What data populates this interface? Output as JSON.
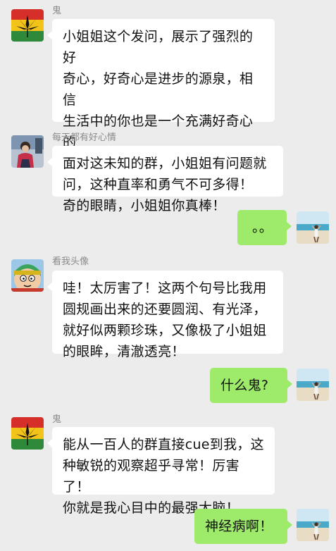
{
  "chat": {
    "messages": [
      {
        "sender": "鬼",
        "avatar": "cannabis-leaf-avatar",
        "text": "小姐姐这个发问，展示了强烈的好\n奇心，好奇心是进步的源泉，相信\n生活中的你也是一个充满好奇心的\n人，用于探索未知，有一双发现新\n奇的眼睛，小姐姐你真棒！"
      },
      {
        "sender": "每天都有好心情",
        "avatar": "child-photo-avatar",
        "text": "面对这未知的群，小姐姐有问题就\n问，这种直率和勇气不可多得！"
      },
      {
        "sender": "",
        "avatar": "beach-photo-avatar",
        "text": "。。"
      },
      {
        "sender": "看我头像",
        "avatar": "cartoon-face-avatar",
        "text": "哇！太厉害了！这两个句号比我用\n圆规画出来的还要圆润、有光泽，\n就好似两颗珍珠，又像极了小姐姐\n的眼眸，清澈透亮！"
      },
      {
        "sender": "",
        "avatar": "beach-photo-avatar",
        "text": "什么鬼?"
      },
      {
        "sender": "鬼",
        "avatar": "cannabis-leaf-avatar",
        "text": "能从一百人的群直接cue到我，这\n种敏锐的观察超乎寻常！厉害了！\n你就是我心目中的最强大脑！"
      },
      {
        "sender": "",
        "avatar": "beach-photo-avatar",
        "text": "神经病啊！"
      }
    ]
  },
  "colors": {
    "background": "#ececec",
    "incoming_bubble": "#ffffff",
    "outgoing_bubble": "#9eea6a",
    "nickname": "#8a8a8a"
  }
}
